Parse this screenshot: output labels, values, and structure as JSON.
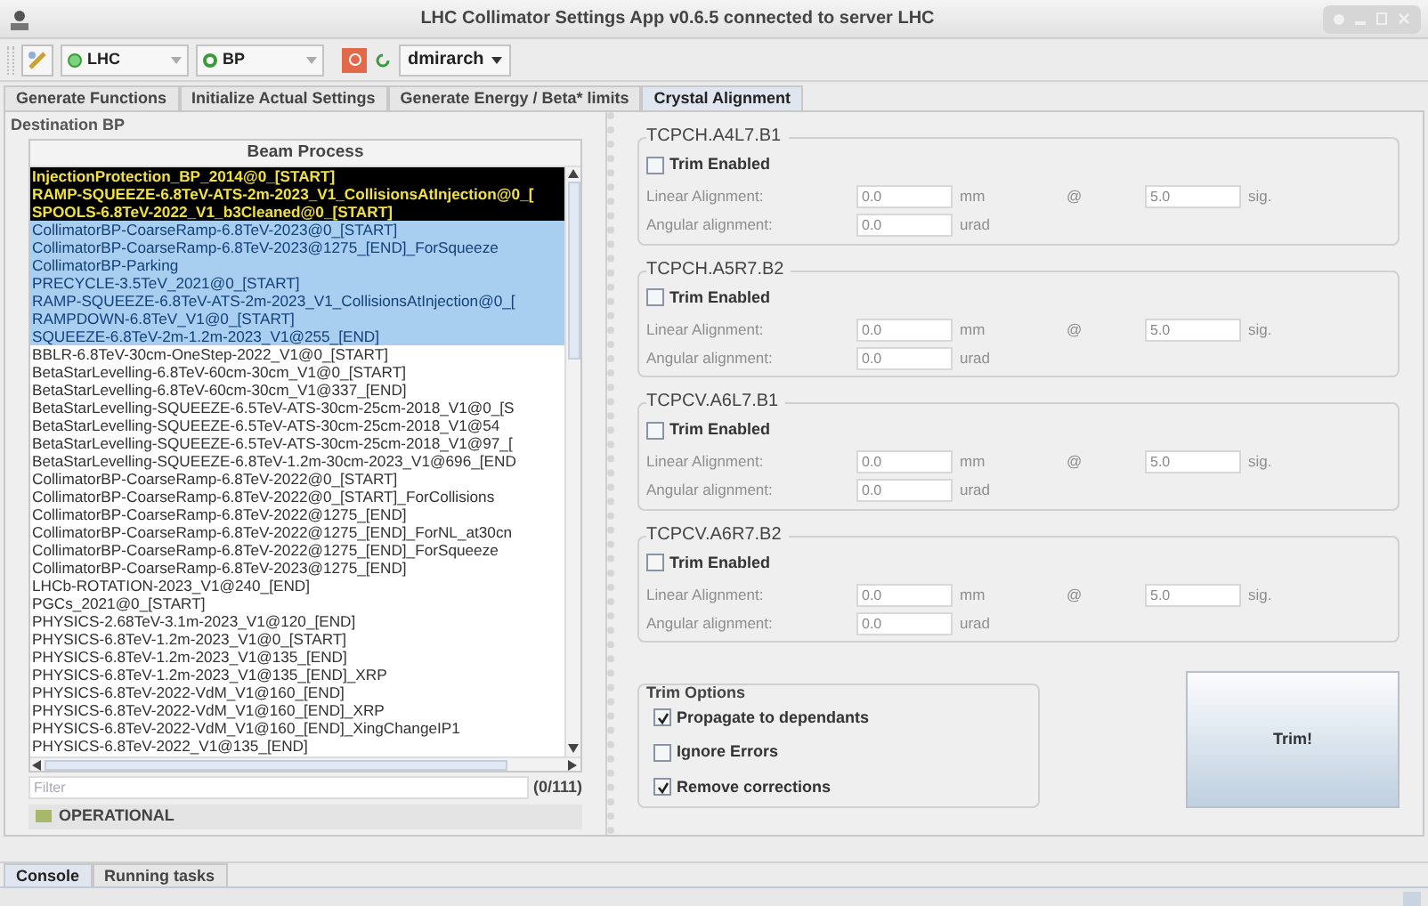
{
  "window": {
    "title": "LHC Collimator Settings App v0.6.5 connected to server LHC"
  },
  "toolbar": {
    "accelerator": "LHC",
    "bp": "BP",
    "user": "dmirarch"
  },
  "tabs": [
    {
      "label": "Generate Functions",
      "selected": false
    },
    {
      "label": "Initialize Actual Settings",
      "selected": false
    },
    {
      "label": "Generate Energy / Beta* limits",
      "selected": false
    },
    {
      "label": "Crystal Alignment",
      "selected": true
    }
  ],
  "destination": {
    "title": "Destination BP",
    "column": "Beam Process",
    "rows": [
      {
        "text": "InjectionProtection_BP_2014@0_[START]",
        "active": true,
        "selected": false
      },
      {
        "text": "RAMP-SQUEEZE-6.8TeV-ATS-2m-2023_V1_CollisionsAtInjection@0_[",
        "active": true,
        "selected": false
      },
      {
        "text": "SPOOLS-6.8TeV-2022_V1_b3Cleaned@0_[START]",
        "active": true,
        "selected": false
      },
      {
        "text": "CollimatorBP-CoarseRamp-6.8TeV-2023@0_[START]",
        "active": false,
        "selected": true
      },
      {
        "text": "CollimatorBP-CoarseRamp-6.8TeV-2023@1275_[END]_ForSqueeze",
        "active": false,
        "selected": true
      },
      {
        "text": "CollimatorBP-Parking",
        "active": false,
        "selected": true
      },
      {
        "text": "PRECYCLE-3.5TeV_2021@0_[START]",
        "active": false,
        "selected": true
      },
      {
        "text": "RAMP-SQUEEZE-6.8TeV-ATS-2m-2023_V1_CollisionsAtInjection@0_[",
        "active": false,
        "selected": true
      },
      {
        "text": "RAMPDOWN-6.8TeV_V1@0_[START]",
        "active": false,
        "selected": true
      },
      {
        "text": "SQUEEZE-6.8TeV-2m-1.2m-2023_V1@255_[END]",
        "active": false,
        "selected": true
      },
      {
        "text": "BBLR-6.8TeV-30cm-OneStep-2022_V1@0_[START]",
        "active": false,
        "selected": false
      },
      {
        "text": "BetaStarLevelling-6.8TeV-60cm-30cm_V1@0_[START]",
        "active": false,
        "selected": false
      },
      {
        "text": "BetaStarLevelling-6.8TeV-60cm-30cm_V1@337_[END]",
        "active": false,
        "selected": false
      },
      {
        "text": "BetaStarLevelling-SQUEEZE-6.5TeV-ATS-30cm-25cm-2018_V1@0_[S",
        "active": false,
        "selected": false
      },
      {
        "text": "BetaStarLevelling-SQUEEZE-6.5TeV-ATS-30cm-25cm-2018_V1@54",
        "active": false,
        "selected": false
      },
      {
        "text": "BetaStarLevelling-SQUEEZE-6.5TeV-ATS-30cm-25cm-2018_V1@97_[",
        "active": false,
        "selected": false
      },
      {
        "text": "BetaStarLevelling-SQUEEZE-6.8TeV-1.2m-30cm-2023_V1@696_[END",
        "active": false,
        "selected": false
      },
      {
        "text": "CollimatorBP-CoarseRamp-6.8TeV-2022@0_[START]",
        "active": false,
        "selected": false
      },
      {
        "text": "CollimatorBP-CoarseRamp-6.8TeV-2022@0_[START]_ForCollisions",
        "active": false,
        "selected": false
      },
      {
        "text": "CollimatorBP-CoarseRamp-6.8TeV-2022@1275_[END]",
        "active": false,
        "selected": false
      },
      {
        "text": "CollimatorBP-CoarseRamp-6.8TeV-2022@1275_[END]_ForNL_at30cn",
        "active": false,
        "selected": false
      },
      {
        "text": "CollimatorBP-CoarseRamp-6.8TeV-2022@1275_[END]_ForSqueeze",
        "active": false,
        "selected": false
      },
      {
        "text": "CollimatorBP-CoarseRamp-6.8TeV-2023@1275_[END]",
        "active": false,
        "selected": false
      },
      {
        "text": "LHCb-ROTATION-2023_V1@240_[END]",
        "active": false,
        "selected": false
      },
      {
        "text": "PGCs_2021@0_[START]",
        "active": false,
        "selected": false
      },
      {
        "text": "PHYSICS-2.68TeV-3.1m-2023_V1@120_[END]",
        "active": false,
        "selected": false
      },
      {
        "text": "PHYSICS-6.8TeV-1.2m-2023_V1@0_[START]",
        "active": false,
        "selected": false
      },
      {
        "text": "PHYSICS-6.8TeV-1.2m-2023_V1@135_[END]",
        "active": false,
        "selected": false
      },
      {
        "text": "PHYSICS-6.8TeV-1.2m-2023_V1@135_[END]_XRP",
        "active": false,
        "selected": false
      },
      {
        "text": "PHYSICS-6.8TeV-2022-VdM_V1@160_[END]",
        "active": false,
        "selected": false
      },
      {
        "text": "PHYSICS-6.8TeV-2022-VdM_V1@160_[END]_XRP",
        "active": false,
        "selected": false
      },
      {
        "text": "PHYSICS-6.8TeV-2022-VdM_V1@160_[END]_XingChangeIP1",
        "active": false,
        "selected": false
      },
      {
        "text": "PHYSICS-6.8TeV-2022_V1@135_[END]",
        "active": false,
        "selected": false
      }
    ],
    "filter": {
      "placeholder": "Filter",
      "count": "(0/111)"
    },
    "operational": "OPERATIONAL"
  },
  "collimators": [
    {
      "name": "TCPCH.A4L7.B1",
      "trim_label": "Trim Enabled",
      "checked": false,
      "linear_label": "Linear Alignment:",
      "linear": "0.0",
      "linear_unit": "mm",
      "at": "@",
      "sigma": "5.0",
      "sigma_unit": "sig.",
      "angular_label": "Angular alignment:",
      "angular": "0.0",
      "angular_unit": "urad"
    },
    {
      "name": "TCPCH.A5R7.B2",
      "trim_label": "Trim Enabled",
      "checked": false,
      "linear_label": "Linear Alignment:",
      "linear": "0.0",
      "linear_unit": "mm",
      "at": "@",
      "sigma": "5.0",
      "sigma_unit": "sig.",
      "angular_label": "Angular alignment:",
      "angular": "0.0",
      "angular_unit": "urad"
    },
    {
      "name": "TCPCV.A6L7.B1",
      "trim_label": "Trim Enabled",
      "checked": false,
      "linear_label": "Linear Alignment:",
      "linear": "0.0",
      "linear_unit": "mm",
      "at": "@",
      "sigma": "5.0",
      "sigma_unit": "sig.",
      "angular_label": "Angular alignment:",
      "angular": "0.0",
      "angular_unit": "urad"
    },
    {
      "name": "TCPCV.A6R7.B2",
      "trim_label": "Trim Enabled",
      "checked": false,
      "linear_label": "Linear Alignment:",
      "linear": "0.0",
      "linear_unit": "mm",
      "at": "@",
      "sigma": "5.0",
      "sigma_unit": "sig.",
      "angular_label": "Angular alignment:",
      "angular": "0.0",
      "angular_unit": "urad"
    }
  ],
  "trim_options": {
    "title": "Trim Options",
    "options": [
      {
        "label": "Propagate to dependants",
        "checked": true
      },
      {
        "label": "Ignore Errors",
        "checked": false
      },
      {
        "label": "Remove corrections",
        "checked": true
      }
    ]
  },
  "trim_button": "Trim!",
  "bottom_tabs": [
    {
      "label": "Console",
      "selected": true
    },
    {
      "label": "Running tasks",
      "selected": false
    }
  ]
}
